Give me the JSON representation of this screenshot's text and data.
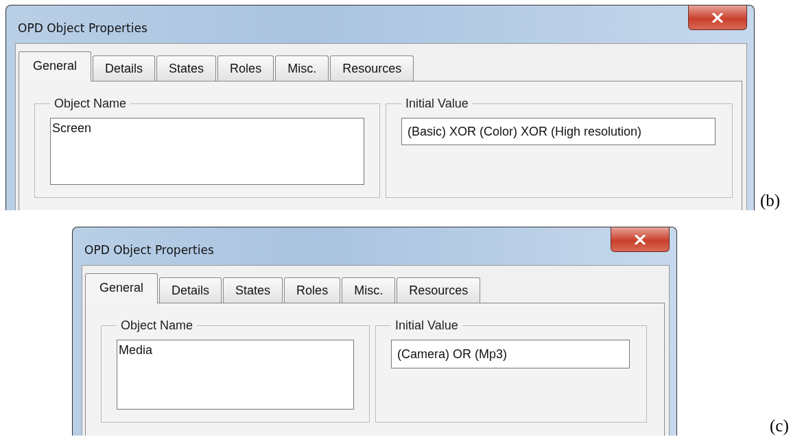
{
  "panels": [
    {
      "label": "(b)",
      "window": {
        "title": "OPD Object Properties"
      },
      "tabs": [
        {
          "label": "General",
          "selected": true
        },
        {
          "label": "Details",
          "selected": false
        },
        {
          "label": "States",
          "selected": false
        },
        {
          "label": "Roles",
          "selected": false
        },
        {
          "label": "Misc.",
          "selected": false
        },
        {
          "label": "Resources",
          "selected": false
        }
      ],
      "object_name": {
        "legend": "Object Name",
        "value": "Screen"
      },
      "initial_value": {
        "legend": "Initial Value",
        "value": "(Basic) XOR (Color) XOR (High resolution)"
      }
    },
    {
      "label": "(c)",
      "window": {
        "title": "OPD Object Properties"
      },
      "tabs": [
        {
          "label": "General",
          "selected": true
        },
        {
          "label": "Details",
          "selected": false
        },
        {
          "label": "States",
          "selected": false
        },
        {
          "label": "Roles",
          "selected": false
        },
        {
          "label": "Misc.",
          "selected": false
        },
        {
          "label": "Resources",
          "selected": false
        }
      ],
      "object_name": {
        "legend": "Object Name",
        "value": "Media"
      },
      "initial_value": {
        "legend": "Initial Value",
        "value": "(Camera) OR (Mp3)"
      }
    }
  ]
}
